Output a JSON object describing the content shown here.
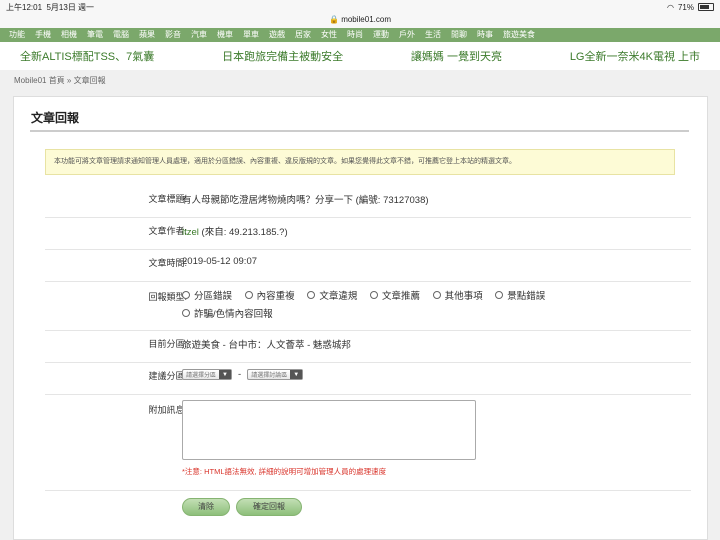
{
  "status": {
    "time": "上午12:01",
    "date": "5月13日 週一",
    "battery": "71%"
  },
  "url": "mobile01.com",
  "nav": [
    "功能",
    "手機",
    "相機",
    "筆電",
    "電腦",
    "蘋果",
    "影音",
    "汽車",
    "機車",
    "單車",
    "遊戲",
    "居家",
    "女性",
    "時尚",
    "運動",
    "戶外",
    "生活",
    "閒聊",
    "時事",
    "旅遊美食"
  ],
  "promos": [
    "全新ALTIS標配TSS、7氣囊",
    "日本跑旅完備主被動安全",
    "讓媽媽 一覺到天亮",
    "LG全新一奈米4K電視 上市"
  ],
  "breadcrumb": "Mobile01 首頁 » 文章回報",
  "form": {
    "title": "文章回報",
    "notice": "本功能可將文章管理請求通知管理人員處理，適用於分區錯誤、內容重複、違反版規的文章。如果您覺得此文章不錯，可推薦它登上本站的精選文章。",
    "article_title_label": "文章標題:",
    "article_title": "有人母親節吃澄居烤物燒肉嗎？分享一下 (編號: 73127038)",
    "author_label": "文章作者:",
    "author_name": "ltzel",
    "author_from": "(來自: 49.213.185.?)",
    "time_label": "文章時間:",
    "time": "2019-05-12 09:07",
    "type_label": "回報類型:",
    "types": [
      "分區錯誤",
      "內容重複",
      "文章違規",
      "文章推薦",
      "其他事項",
      "景點錯誤",
      "詐騙/色情內容回報"
    ],
    "current_label": "目前分區:",
    "current": "旅遊美食 - 台中市：人文薈萃 - 魅惑城邦",
    "suggest_label": "建議分區:",
    "suggest_select1": "請選擇分區",
    "suggest_dash": "-",
    "suggest_select2": "請選擇討論區",
    "extra_label": "附加訊息:",
    "warning": "*注意: HTML語法無效, 詳細的說明可增加管理人員的處理速度",
    "clear_btn": "清除",
    "submit_btn": "確定回報"
  }
}
